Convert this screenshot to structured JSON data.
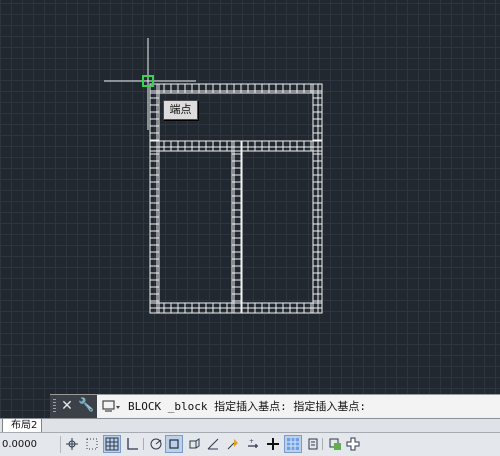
{
  "drawing": {
    "osnap_tooltip": "端点"
  },
  "command_line": {
    "close_icon": "close-icon",
    "settings_icon": "wrench-icon",
    "text": "BLOCK _block 指定插入基点: 指定插入基点:"
  },
  "layout_tabs": [
    {
      "label": "布局2",
      "active": true
    }
  ],
  "status_bar": {
    "coordinates": "0.0000",
    "buttons": [
      {
        "name": "infer-constraints",
        "icon": "infer-icon",
        "on": false
      },
      {
        "name": "snap-mode",
        "icon": "snap-icon",
        "on": false
      },
      {
        "name": "grid-display",
        "icon": "grid-icon",
        "on": true
      },
      {
        "name": "ortho-mode",
        "icon": "ortho-icon",
        "on": false
      },
      {
        "name": "polar-tracking",
        "icon": "polar-icon",
        "on": false
      },
      {
        "name": "object-snap",
        "icon": "osnap-icon",
        "on": true
      },
      {
        "name": "3d-object-snap",
        "icon": "3dosnap-icon",
        "on": false
      },
      {
        "name": "object-snap-tracking",
        "icon": "otrack-icon",
        "on": false
      },
      {
        "name": "dynamic-ucs",
        "icon": "ducs-icon",
        "on": false
      },
      {
        "name": "dynamic-input",
        "icon": "dyn-icon",
        "on": false
      },
      {
        "name": "lineweight",
        "icon": "lineweight-icon",
        "on": false
      },
      {
        "name": "transparency",
        "icon": "transparency-icon",
        "on": true
      },
      {
        "name": "quick-properties",
        "icon": "qp-icon",
        "on": false
      },
      {
        "name": "selection-cycling",
        "icon": "sc-icon",
        "on": false
      },
      {
        "name": "annotation-monitor",
        "icon": "am-icon",
        "on": false
      }
    ]
  },
  "colors": {
    "background": "#212830",
    "grid": "#2c3540",
    "geometry": "#f2f2f2",
    "snap_marker": "#39d353"
  }
}
